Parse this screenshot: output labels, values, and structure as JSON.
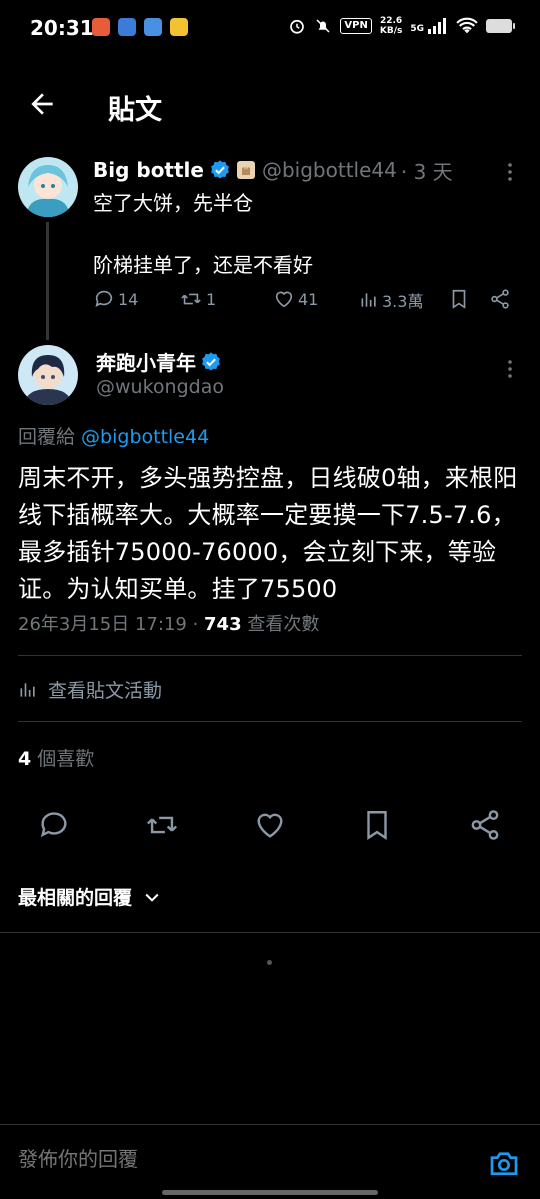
{
  "status_bar": {
    "time": "20:31",
    "vpn": "VPN",
    "speed_value": "22.6",
    "speed_unit": "KB/s",
    "network": "5G"
  },
  "header": {
    "title": "貼文"
  },
  "parent_post": {
    "name": "Big bottle",
    "handle": "@bigbottle44",
    "time": "· 3 天",
    "text": "空了大饼，先半仓\n\n阶梯挂单了，还是不看好",
    "replies": "14",
    "reposts": "1",
    "likes": "41",
    "views": "3.3萬"
  },
  "main_post": {
    "name": "奔跑小青年",
    "handle": "@wukongdao",
    "reply_prefix": "回覆給 ",
    "reply_to": "@bigbottle44",
    "text": "周末不开，多头强势控盘，日线破0轴，来根阳线下插概率大。大概率一定要摸一下7.5-7.6，最多插针75000-76000，会立刻下来，等验证。为认知买单。挂了75500",
    "date": "26年3月15日 17:19 · ",
    "view_count": "743",
    "view_label": " 查看次數",
    "activity_label": "查看貼文活動",
    "like_count": "4",
    "like_label": " 個喜歡"
  },
  "sort_label": "最相關的回覆",
  "reply_bar": {
    "placeholder": "發佈你的回覆"
  },
  "colors": {
    "accent": "#1d9bf0",
    "verified": "#1d9bf0",
    "background": "#000000"
  }
}
